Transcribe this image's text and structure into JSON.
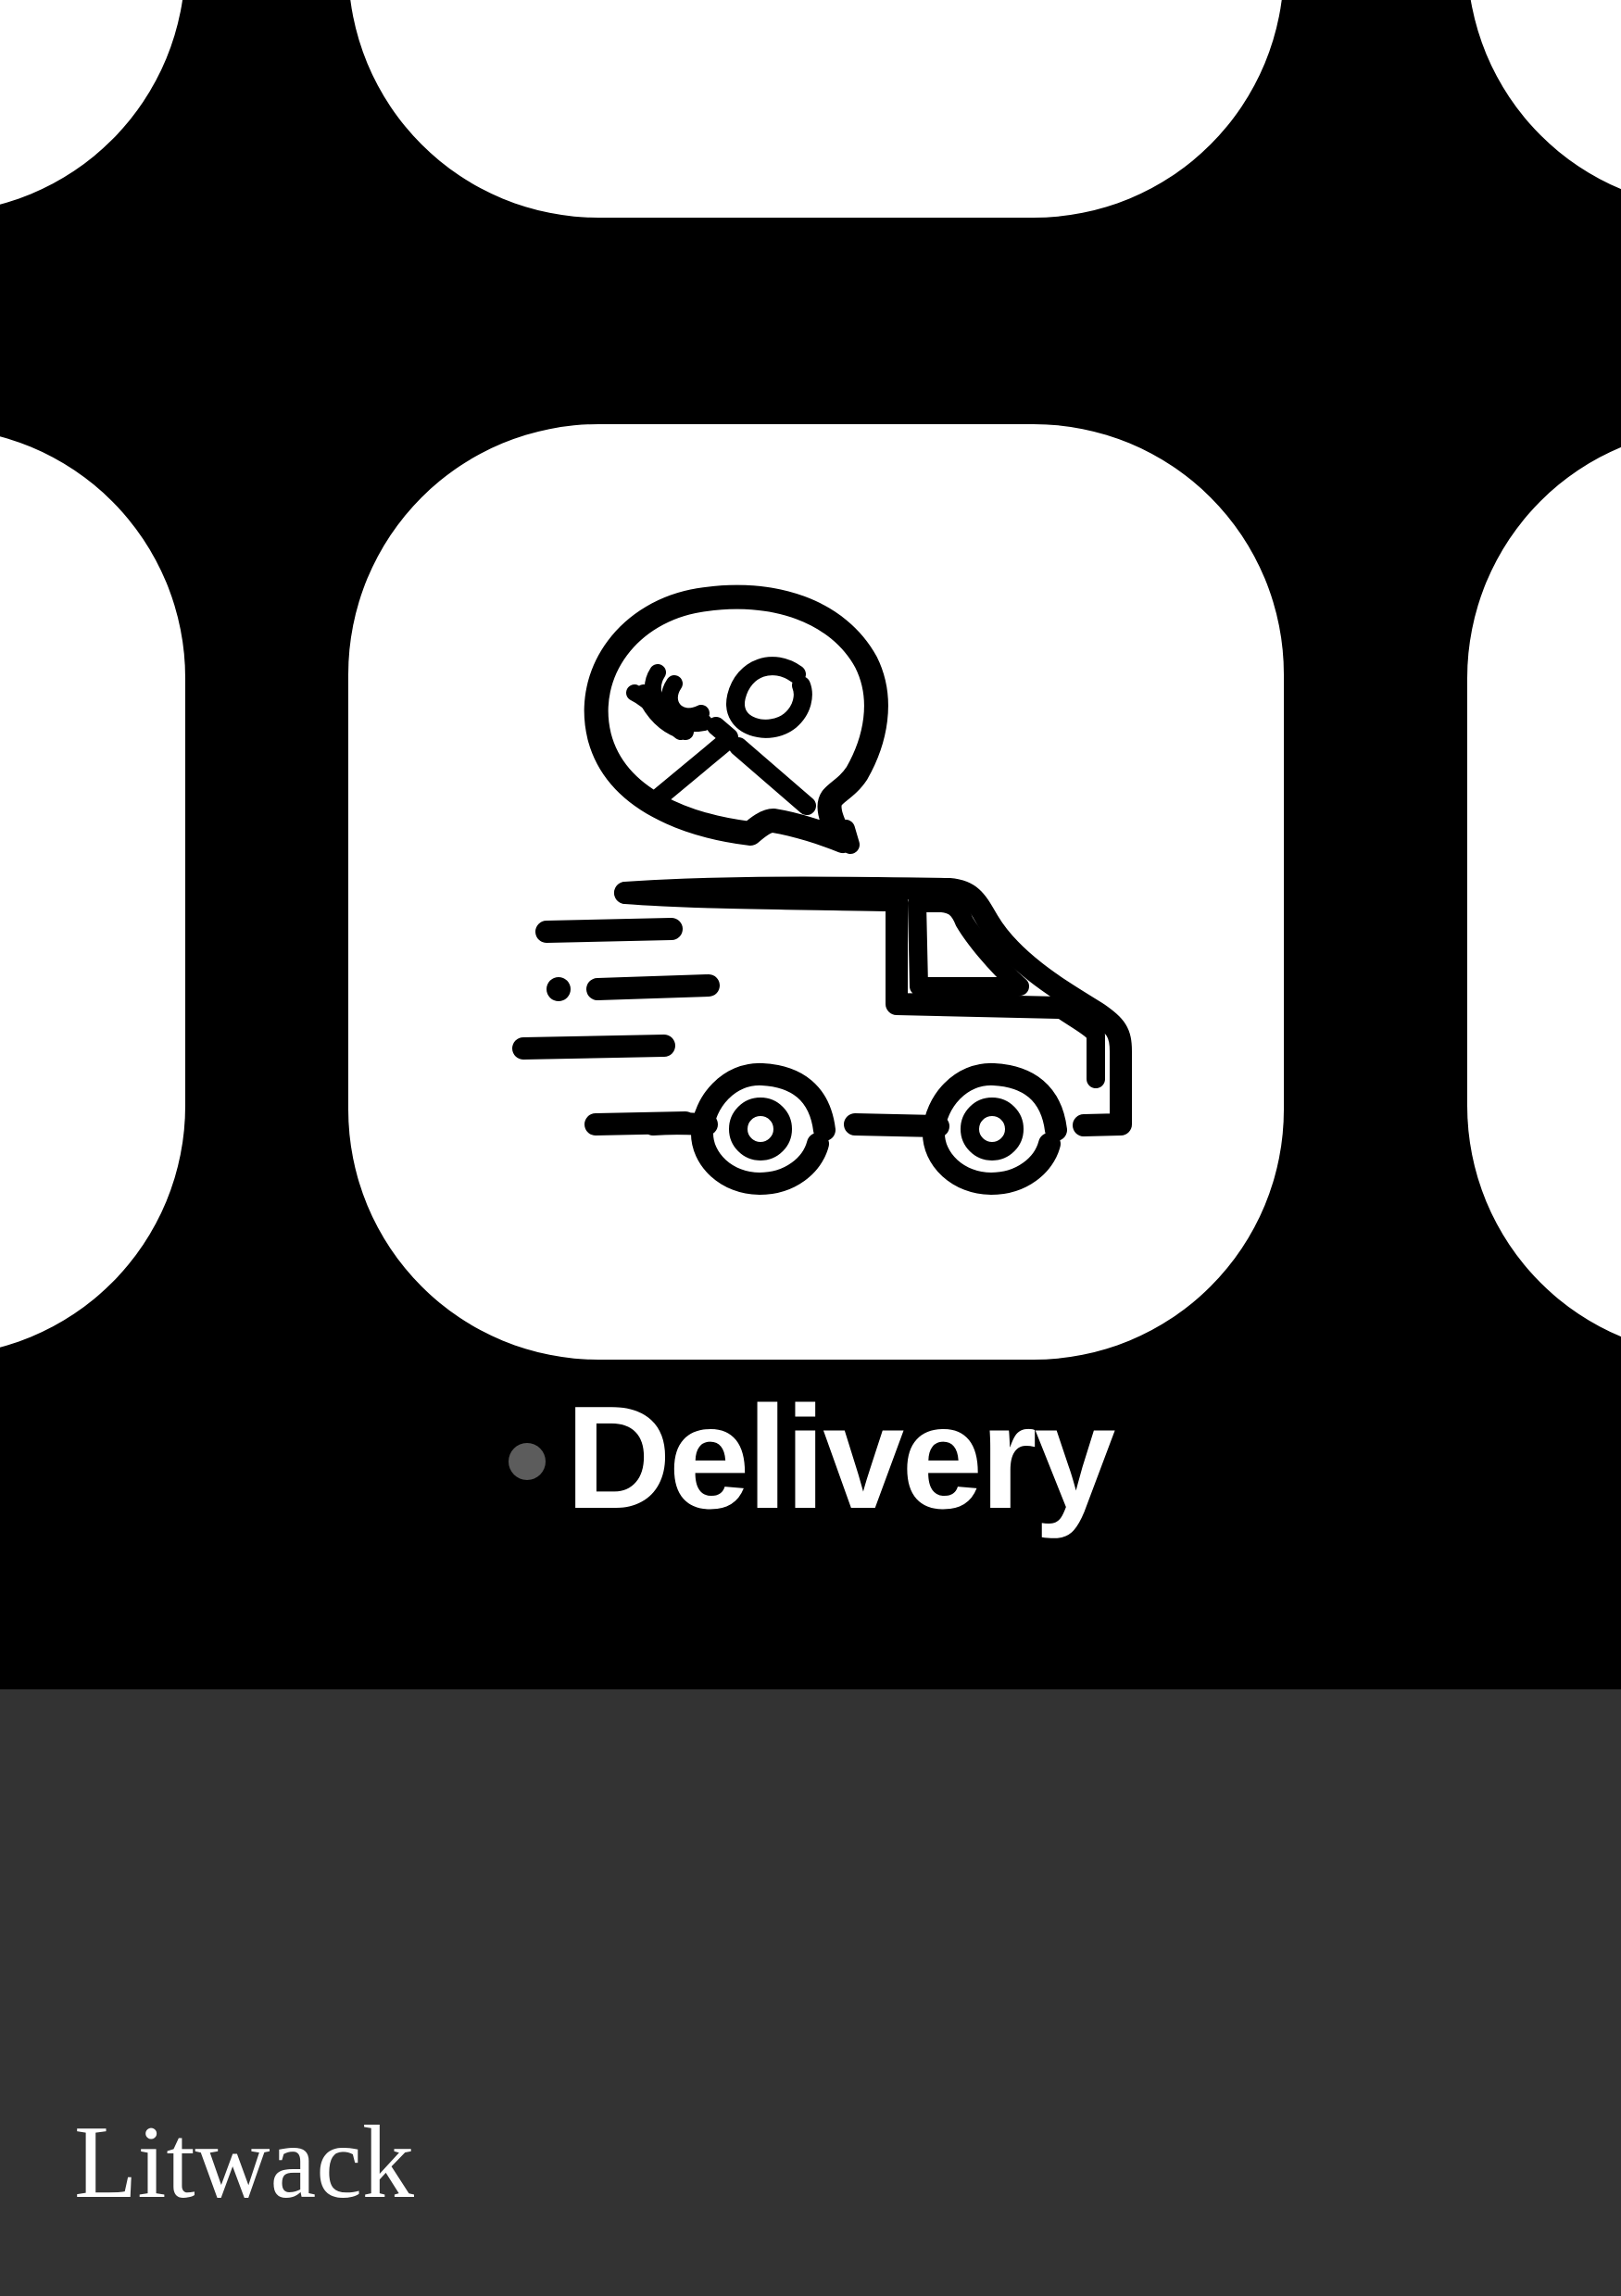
{
  "app": {
    "name": "Delivery",
    "icon": "food-delivery-van-icon",
    "has_notification_dot": true
  },
  "footer": {
    "brand": "Litwack"
  },
  "colors": {
    "background": "#000000",
    "tile": "#ffffff",
    "icon_stroke": "#000000",
    "label_text": "#ffffff",
    "notification_dot": "#5c5c5c",
    "footer_background": "#333333",
    "footer_text": "#ffffff"
  }
}
